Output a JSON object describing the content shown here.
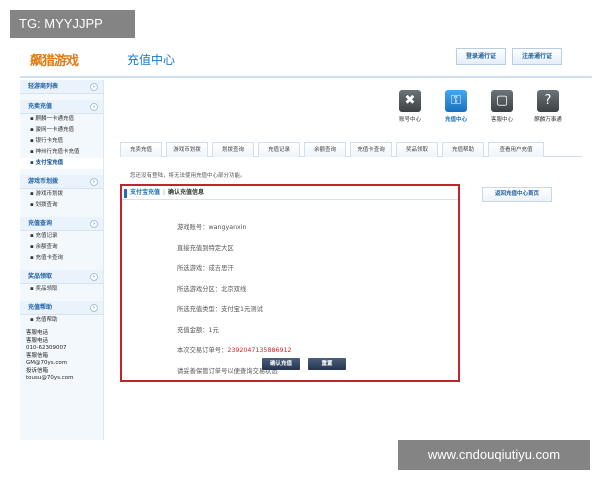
{
  "watermarks": {
    "top_left": "TG: MYYJJPP",
    "bottom_right": "www.cndouqiutiyu.com"
  },
  "header": {
    "logo": "飙猎游戏",
    "title": "充值中心",
    "buttons": [
      "登录通行证",
      "注册通行证"
    ]
  },
  "sidebar": {
    "groups": [
      {
        "title": "轻游商列表",
        "items": []
      },
      {
        "title": "充卖充值",
        "items": [
          "麒麟一卡通充值",
          "骏网一卡通充值",
          "银行卡充值",
          "神州行充值卡充值",
          "支付宝充值"
        ]
      },
      {
        "title": "游戏币划拨",
        "items": [
          "游戏币划拨",
          "划拨查询"
        ]
      },
      {
        "title": "充值查询",
        "items": [
          "充值记录",
          "余额查询",
          "充值卡查询"
        ]
      },
      {
        "title": "奖品领取",
        "items": [
          "奖品领取"
        ]
      },
      {
        "title": "充值帮助",
        "items": [
          "充值帮助"
        ]
      }
    ],
    "active_item": "支付宝充值",
    "contact": [
      "客服电话",
      "客服电话",
      "010-62309007",
      "客服信箱",
      "GM@70ys.com",
      "投诉信箱",
      "tousu@70ys.com"
    ]
  },
  "icons": [
    {
      "label": "账号中心",
      "icon": "tools-icon",
      "glyph": "✖"
    },
    {
      "label": "充值中心",
      "icon": "key-icon",
      "glyph": "🔑"
    },
    {
      "label": "客服中心",
      "icon": "chat-icon",
      "glyph": "☐"
    },
    {
      "label": "麒麟万事通",
      "icon": "help-icon",
      "glyph": "?"
    }
  ],
  "tabs": [
    "充卖充值",
    "游戏币划拨",
    "划拨查询",
    "充值记录",
    "余额查询",
    "充值卡查询",
    "奖品领取",
    "充值帮助",
    "查看用户充值"
  ],
  "notice": "您还没有登陆，将无法使用充值中心部分功能。",
  "panel": {
    "tab": "支付宝充值",
    "separator": "|",
    "title": "确认充值信息",
    "rows": [
      {
        "label": "游戏账号：",
        "value": "wangyanxin"
      },
      {
        "label": "直接充值到特定大区",
        "value": ""
      },
      {
        "label": "所选游戏：",
        "value": "成吉思汗"
      },
      {
        "label": "所选游戏分区：",
        "value": "北京双线"
      },
      {
        "label": "所选充值类型：",
        "value": "支付宝1元测试"
      },
      {
        "label": "充值金额：",
        "value": "1元"
      },
      {
        "label": "本次交易订单号：",
        "value": "2392047135886912"
      },
      {
        "label": "请妥善保管订单号以便查询交易状态",
        "value": ""
      }
    ],
    "confirm_label": "确认充值",
    "back_label": "重置"
  },
  "side_link": "返回充值中心首页"
}
